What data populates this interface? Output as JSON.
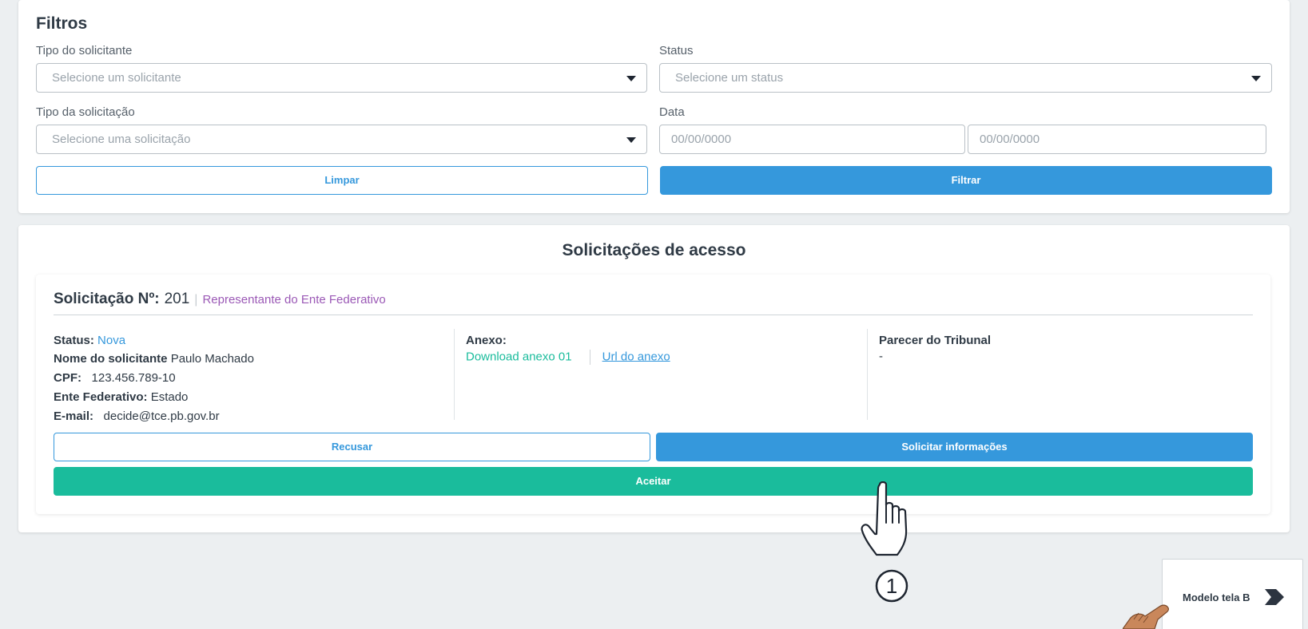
{
  "filters": {
    "title": "Filtros",
    "requester_type": {
      "label": "Tipo do solicitante",
      "placeholder": "Selecione um solicitante"
    },
    "status": {
      "label": "Status",
      "placeholder": "Selecione um status"
    },
    "request_type": {
      "label": "Tipo da solicitação",
      "placeholder": "Selecione uma solicitação"
    },
    "date": {
      "label": "Data",
      "from_placeholder": "00/00/0000",
      "to_placeholder": "00/00/0000"
    },
    "clear_label": "Limpar",
    "filter_label": "Filtrar"
  },
  "requests": {
    "title": "Solicitações de acesso",
    "item": {
      "number_label": "Solicitação Nº:",
      "number": "201",
      "separator": "|",
      "type": "Representante do Ente Federativo",
      "status_label": "Status:",
      "status_value": "Nova",
      "requester_label": "Nome do solicitante",
      "requester_value": "Paulo Machado",
      "cpf_label": "CPF:",
      "cpf_value": "123.456.789-10",
      "ente_label": "Ente Federativo:",
      "ente_value": "Estado",
      "email_label": "E-mail:",
      "email_value": "decide@tce.pb.gov.br",
      "annex_label": "Anexo:",
      "annex_download": "Download anexo 01",
      "annex_url": "Url do anexo",
      "opinion_label": "Parecer do Tribunal",
      "opinion_value": "-",
      "refuse_label": "Recusar",
      "request_info_label": "Solicitar informações",
      "accept_label": "Aceitar"
    }
  },
  "annotation": {
    "step_number": "1"
  },
  "navigation": {
    "next_screen_label": "Modelo tela B",
    "next_icon": "chevron-right-icon"
  },
  "colors": {
    "primary": "#3598dc",
    "success": "#1abc9c",
    "purple": "#9b59b6",
    "background": "#eceff1",
    "text": "#2f3a45"
  }
}
